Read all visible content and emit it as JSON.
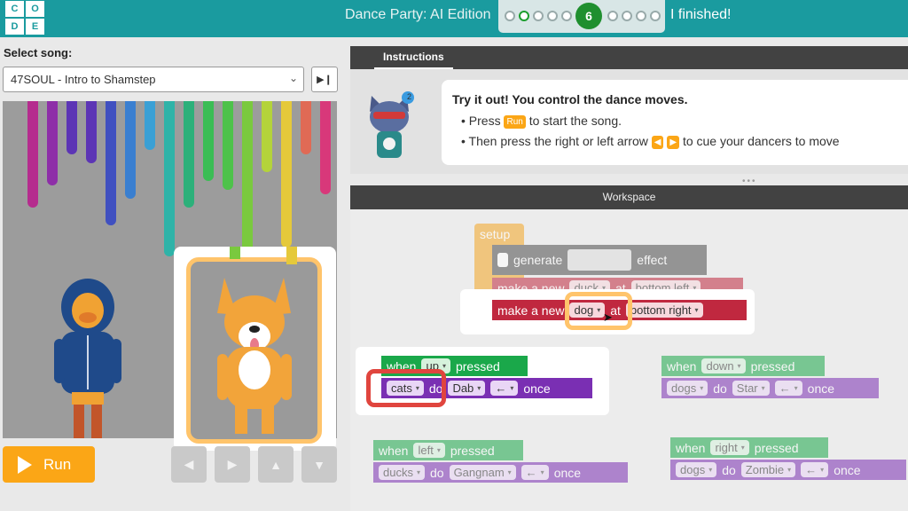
{
  "header": {
    "logo_letters": [
      "C",
      "O",
      "D",
      "E"
    ],
    "title": "Dance Party: AI Edition",
    "current_level": "6",
    "finished_label": "I finished!"
  },
  "song": {
    "label": "Select song:",
    "selected": "47SOUL - Intro to Shamstep"
  },
  "controls": {
    "run_label": "Run",
    "arrow_left": "◀",
    "arrow_right": "▶",
    "arrow_up": "▲",
    "arrow_down": "▼"
  },
  "instructions": {
    "tab": "Instructions",
    "heading": "Try it out! You control the dance moves.",
    "line1_pre": "Press",
    "line1_btn": "Run",
    "line1_post": "to start the song.",
    "line2_pre": "Then press the right or left arrow",
    "line2_post": "to cue your dancers to move",
    "hint_count": "2"
  },
  "workspace": {
    "title": "Workspace",
    "setup_label": "setup",
    "generate": "generate",
    "effect": "effect",
    "make1": {
      "pre": "make a new",
      "who": "duck",
      "at": "at",
      "where": "bottom left"
    },
    "make2": {
      "pre": "make a new",
      "who": "dog",
      "at": "at",
      "where": "bottom right"
    },
    "events": [
      {
        "when": "when",
        "key": "up",
        "pressed": "pressed",
        "who": "cats",
        "do": "do",
        "move": "Dab",
        "dir": "←",
        "once": "once"
      },
      {
        "when": "when",
        "key": "down",
        "pressed": "pressed",
        "who": "dogs",
        "do": "do",
        "move": "Star",
        "dir": "←",
        "once": "once"
      },
      {
        "when": "when",
        "key": "left",
        "pressed": "pressed",
        "who": "ducks",
        "do": "do",
        "move": "Gangnam",
        "dir": "←",
        "once": "once"
      },
      {
        "when": "when",
        "key": "right",
        "pressed": "pressed",
        "who": "dogs",
        "do": "do",
        "move": "Zombie",
        "dir": "←",
        "once": "once"
      }
    ]
  },
  "colors": {
    "header": "#1a9b9f",
    "run": "#fba616",
    "event_green": "#1aa84a",
    "action_purple": "#7a2fb3",
    "sprite_red": "#c0283f",
    "ring_orange": "#ffc46b",
    "ring_red": "#e0453e"
  }
}
